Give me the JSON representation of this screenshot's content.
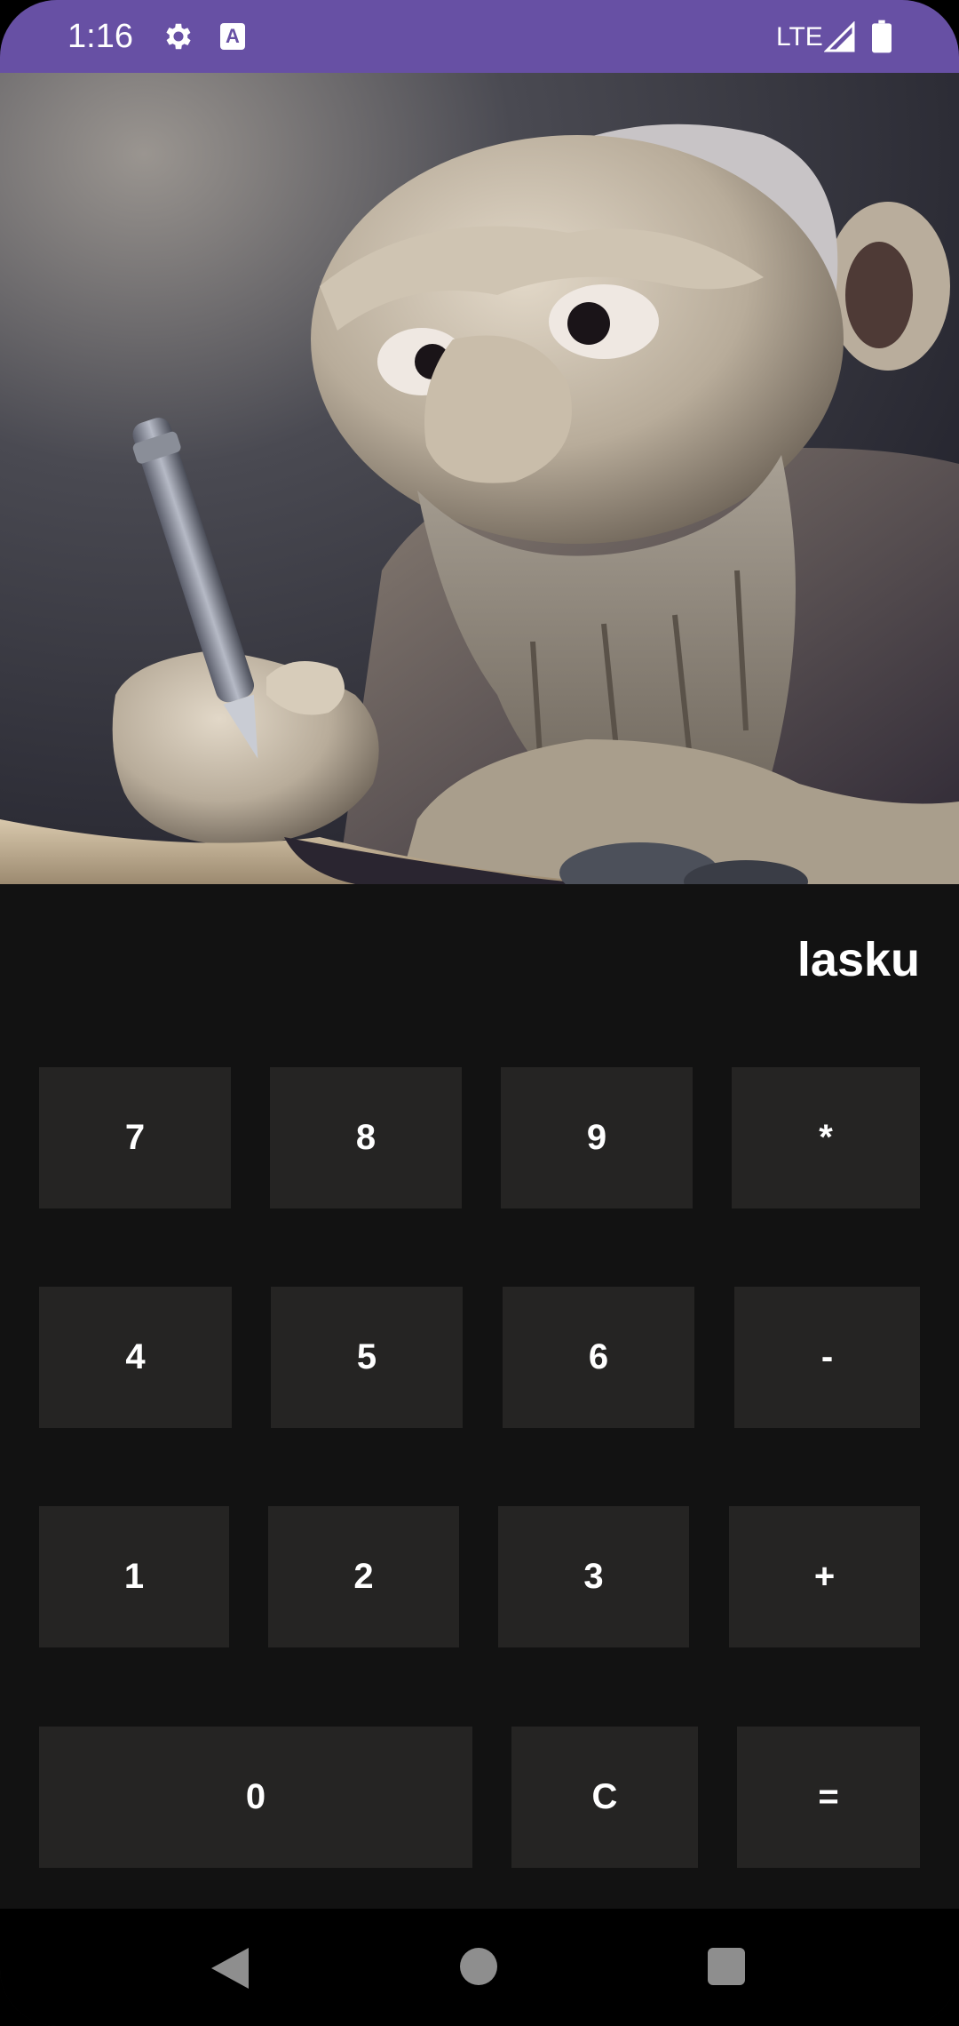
{
  "status_bar": {
    "time": "1:16",
    "app_icon_letter": "A",
    "network": "LTE",
    "icons": [
      "gear-icon",
      "app-notification-icon",
      "signal-icon",
      "battery-icon"
    ]
  },
  "hero": {
    "icon": "stone-troll-writing-illustration"
  },
  "display": {
    "text": "lasku"
  },
  "keys": {
    "k7": "7",
    "k8": "8",
    "k9": "9",
    "mul": "*",
    "k4": "4",
    "k5": "5",
    "k6": "6",
    "sub": "-",
    "k1": "1",
    "k2": "2",
    "k3": "3",
    "add": "+",
    "k0": "0",
    "clear": "C",
    "equals": "="
  },
  "navigation": {
    "icons": [
      "back-icon",
      "home-icon",
      "recents-icon"
    ]
  },
  "colors": {
    "status_bar": "#6750a4",
    "background": "#121212",
    "key": "#252423",
    "text": "#ffffff"
  }
}
